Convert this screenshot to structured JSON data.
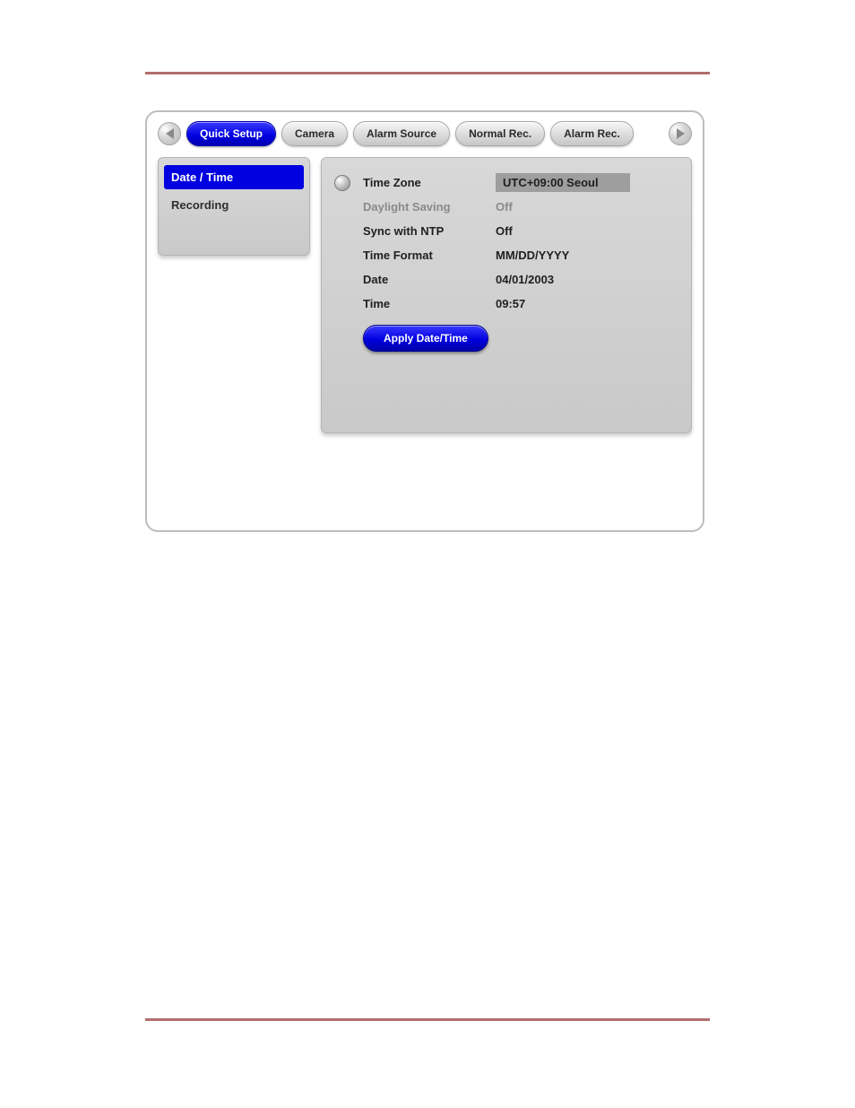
{
  "tabs": {
    "quick_setup": "Quick Setup",
    "camera": "Camera",
    "alarm_source": "Alarm Source",
    "normal_rec": "Normal Rec.",
    "alarm_rec": "Alarm Rec."
  },
  "sidebar": {
    "date_time": "Date / Time",
    "recording": "Recording"
  },
  "settings": {
    "time_zone": {
      "label": "Time Zone",
      "value": "UTC+09:00 Seoul"
    },
    "daylight_saving": {
      "label": "Daylight Saving",
      "value": "Off"
    },
    "sync_ntp": {
      "label": "Sync with NTP",
      "value": "Off"
    },
    "time_format": {
      "label": "Time Format",
      "value": "MM/DD/YYYY"
    },
    "date": {
      "label": "Date",
      "value": "04/01/2003"
    },
    "time": {
      "label": "Time",
      "value": "09:57"
    }
  },
  "buttons": {
    "apply": "Apply Date/Time"
  }
}
